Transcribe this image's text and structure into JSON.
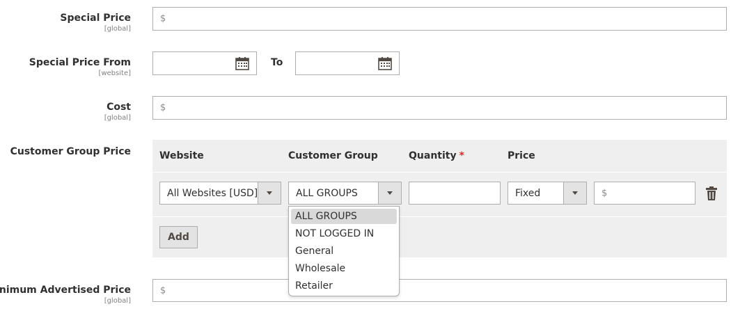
{
  "fields": {
    "special_price": {
      "label": "Special Price",
      "scope": "[global]",
      "prefix": "$",
      "value": ""
    },
    "special_price_from": {
      "label": "Special Price From",
      "scope": "[website]",
      "to_label": "To",
      "from_value": "",
      "to_value": ""
    },
    "cost": {
      "label": "Cost",
      "scope": "[global]",
      "prefix": "$",
      "value": ""
    },
    "customer_group_price": {
      "label": "Customer Group Price"
    },
    "min_advertised_price": {
      "label": "Minimum Advertised Price",
      "scope": "[global]",
      "prefix": "$",
      "value": ""
    }
  },
  "tier_grid": {
    "headers": {
      "website": "Website",
      "customer_group": "Customer Group",
      "quantity": "Quantity",
      "price": "Price",
      "required_mark": "*"
    },
    "row": {
      "website": "All Websites [USD]",
      "customer_group": "ALL GROUPS",
      "quantity": "",
      "price_type": "Fixed",
      "price_prefix": "$",
      "price_value": ""
    },
    "add_label": "Add"
  },
  "group_dropdown": {
    "options": [
      "ALL GROUPS",
      "NOT LOGGED IN",
      "General",
      "Wholesale",
      "Retailer"
    ],
    "selected": "ALL GROUPS"
  },
  "icons": {
    "calendar": "calendar-icon",
    "delete": "trash-icon",
    "dropdown": "caret-down-icon"
  },
  "colors": {
    "required": "#e22626",
    "grid_bg": "#efefef",
    "border": "#adadad",
    "option_highlight": "#d9d9d9"
  }
}
